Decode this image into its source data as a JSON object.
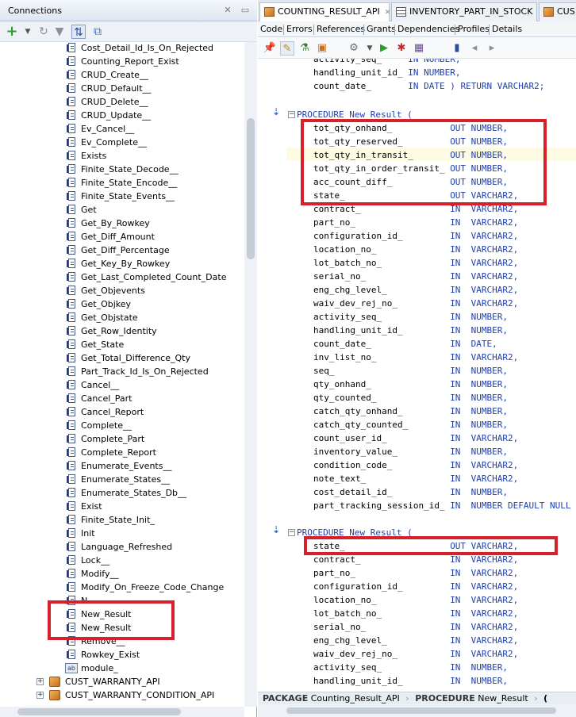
{
  "left_panel": {
    "title": "Connections",
    "toolbar_icons": [
      "add-icon",
      "dropdown-icon",
      "refresh-icon",
      "filter-icon",
      "schema-browser-icon",
      "connection-icon"
    ],
    "tree_items": [
      {
        "label": "Cost_Detail_Id_Is_On_Rejected",
        "icon": "procedure-icon"
      },
      {
        "label": "Counting_Report_Exist",
        "icon": "procedure-icon"
      },
      {
        "label": "CRUD_Create__",
        "icon": "procedure-icon"
      },
      {
        "label": "CRUD_Default__",
        "icon": "procedure-icon"
      },
      {
        "label": "CRUD_Delete__",
        "icon": "procedure-icon"
      },
      {
        "label": "CRUD_Update__",
        "icon": "procedure-icon"
      },
      {
        "label": "Ev_Cancel__",
        "icon": "procedure-icon"
      },
      {
        "label": "Ev_Complete__",
        "icon": "procedure-icon"
      },
      {
        "label": "Exists",
        "icon": "procedure-icon"
      },
      {
        "label": "Finite_State_Decode__",
        "icon": "procedure-icon"
      },
      {
        "label": "Finite_State_Encode__",
        "icon": "procedure-icon"
      },
      {
        "label": "Finite_State_Events__",
        "icon": "procedure-icon"
      },
      {
        "label": "Get",
        "icon": "procedure-icon"
      },
      {
        "label": "Get_By_Rowkey",
        "icon": "procedure-icon"
      },
      {
        "label": "Get_Diff_Amount",
        "icon": "procedure-icon"
      },
      {
        "label": "Get_Diff_Percentage",
        "icon": "procedure-icon"
      },
      {
        "label": "Get_Key_By_Rowkey",
        "icon": "procedure-icon"
      },
      {
        "label": "Get_Last_Completed_Count_Date",
        "icon": "procedure-icon"
      },
      {
        "label": "Get_Objevents",
        "icon": "procedure-icon"
      },
      {
        "label": "Get_Objkey",
        "icon": "procedure-icon"
      },
      {
        "label": "Get_Objstate",
        "icon": "procedure-icon"
      },
      {
        "label": "Get_Row_Identity",
        "icon": "procedure-icon"
      },
      {
        "label": "Get_State",
        "icon": "procedure-icon"
      },
      {
        "label": "Get_Total_Difference_Qty",
        "icon": "procedure-icon"
      },
      {
        "label": "Part_Track_Id_Is_On_Rejected",
        "icon": "procedure-icon"
      },
      {
        "label": "Cancel__",
        "icon": "procedure-icon"
      },
      {
        "label": "Cancel_Part",
        "icon": "procedure-icon"
      },
      {
        "label": "Cancel_Report",
        "icon": "procedure-icon"
      },
      {
        "label": "Complete__",
        "icon": "procedure-icon"
      },
      {
        "label": "Complete_Part",
        "icon": "procedure-icon"
      },
      {
        "label": "Complete_Report",
        "icon": "procedure-icon"
      },
      {
        "label": "Enumerate_Events__",
        "icon": "procedure-icon"
      },
      {
        "label": "Enumerate_States__",
        "icon": "procedure-icon"
      },
      {
        "label": "Enumerate_States_Db__",
        "icon": "procedure-icon"
      },
      {
        "label": "Exist",
        "icon": "procedure-icon"
      },
      {
        "label": "Finite_State_Init_",
        "icon": "procedure-icon"
      },
      {
        "label": "Init",
        "icon": "procedure-icon"
      },
      {
        "label": "Language_Refreshed",
        "icon": "procedure-icon"
      },
      {
        "label": "Lock__",
        "icon": "procedure-icon"
      },
      {
        "label": "Modify__",
        "icon": "procedure-icon"
      },
      {
        "label": "Modify_On_Freeze_Code_Change",
        "icon": "procedure-icon"
      },
      {
        "label": "N",
        "icon": "procedure-icon"
      },
      {
        "label": "New_Result",
        "icon": "procedure-icon"
      },
      {
        "label": "New_Result",
        "icon": "procedure-icon"
      },
      {
        "label": "Remove__",
        "icon": "procedure-icon"
      },
      {
        "label": "Rowkey_Exist",
        "icon": "procedure-icon"
      },
      {
        "label": "module_",
        "icon": "variable-icon"
      }
    ],
    "packages": [
      {
        "label": "CUST_WARRANTY_API",
        "expander": "+"
      },
      {
        "label": "CUST_WARRANTY_CONDITION_API",
        "expander": "+"
      }
    ]
  },
  "tabs": [
    {
      "label": "COUNTING_RESULT_API",
      "icon": "package-icon",
      "active": true
    },
    {
      "label": "INVENTORY_PART_IN_STOCK",
      "icon": "table-icon",
      "active": false
    },
    {
      "label": "CUS",
      "icon": "package-icon",
      "active": false
    }
  ],
  "subtabs": [
    "Code",
    "Errors",
    "References",
    "Grants",
    "Dependencies",
    "Profiles",
    "Details"
  ],
  "code": {
    "top_lines": [
      [
        "activity_seq_",
        "IN NUMBER,"
      ],
      [
        "handling_unit_id_",
        "IN NUMBER,"
      ],
      [
        "count_date_",
        "IN DATE ) RETURN VARCHAR2;"
      ]
    ],
    "proc_header": "PROCEDURE New_Result (",
    "proc1_params": [
      [
        "tot_qty_onhand_",
        "OUT NUMBER,"
      ],
      [
        "tot_qty_reserved_",
        "OUT NUMBER,"
      ],
      [
        "tot_qty_in_transit_",
        "OUT NUMBER,"
      ],
      [
        "tot_qty_in_order_transit_",
        "OUT NUMBER,"
      ],
      [
        "acc_count_diff_",
        "OUT NUMBER,"
      ],
      [
        "state_",
        "OUT VARCHAR2,"
      ],
      [
        "contract_",
        "IN  VARCHAR2,"
      ],
      [
        "part_no_",
        "IN  VARCHAR2,"
      ],
      [
        "configuration_id_",
        "IN  VARCHAR2,"
      ],
      [
        "location_no_",
        "IN  VARCHAR2,"
      ],
      [
        "lot_batch_no_",
        "IN  VARCHAR2,"
      ],
      [
        "serial_no_",
        "IN  VARCHAR2,"
      ],
      [
        "eng_chg_level_",
        "IN  VARCHAR2,"
      ],
      [
        "waiv_dev_rej_no_",
        "IN  VARCHAR2,"
      ],
      [
        "activity_seq_",
        "IN  NUMBER,"
      ],
      [
        "handling_unit_id_",
        "IN  NUMBER,"
      ],
      [
        "count_date_",
        "IN  DATE,"
      ],
      [
        "inv_list_no_",
        "IN  VARCHAR2,"
      ],
      [
        "seq_",
        "IN  NUMBER,"
      ],
      [
        "qty_onhand_",
        "IN  NUMBER,"
      ],
      [
        "qty_counted_",
        "IN  NUMBER,"
      ],
      [
        "catch_qty_onhand_",
        "IN  NUMBER,"
      ],
      [
        "catch_qty_counted_",
        "IN  NUMBER,"
      ],
      [
        "count_user_id_",
        "IN  VARCHAR2,"
      ],
      [
        "inventory_value_",
        "IN  NUMBER,"
      ],
      [
        "condition_code_",
        "IN  VARCHAR2,"
      ],
      [
        "note_text_",
        "IN  VARCHAR2,"
      ],
      [
        "cost_detail_id_",
        "IN  NUMBER,"
      ],
      [
        "part_tracking_session_id_",
        "IN  NUMBER DEFAULT NULL"
      ]
    ],
    "proc2_params": [
      [
        "state_",
        "OUT VARCHAR2,"
      ],
      [
        "contract_",
        "IN  VARCHAR2,"
      ],
      [
        "part_no_",
        "IN  VARCHAR2,"
      ],
      [
        "configuration_id_",
        "IN  VARCHAR2,"
      ],
      [
        "location_no_",
        "IN  VARCHAR2,"
      ],
      [
        "lot_batch_no_",
        "IN  VARCHAR2,"
      ],
      [
        "serial_no_",
        "IN  VARCHAR2,"
      ],
      [
        "eng_chg_level_",
        "IN  VARCHAR2,"
      ],
      [
        "waiv_dev_rej_no_",
        "IN  VARCHAR2,"
      ],
      [
        "activity_seq_",
        "IN  NUMBER,"
      ],
      [
        "handling_unit_id_",
        "IN  NUMBER,"
      ]
    ]
  },
  "breadcrumb": {
    "kw1": "PACKAGE",
    "name1": "Counting_Result_API",
    "kw2": "PROCEDURE",
    "name2": "New_Result",
    "tail": "("
  },
  "colors": {
    "highlight_box": "#d6202a",
    "keyword": "#1f3fae"
  }
}
